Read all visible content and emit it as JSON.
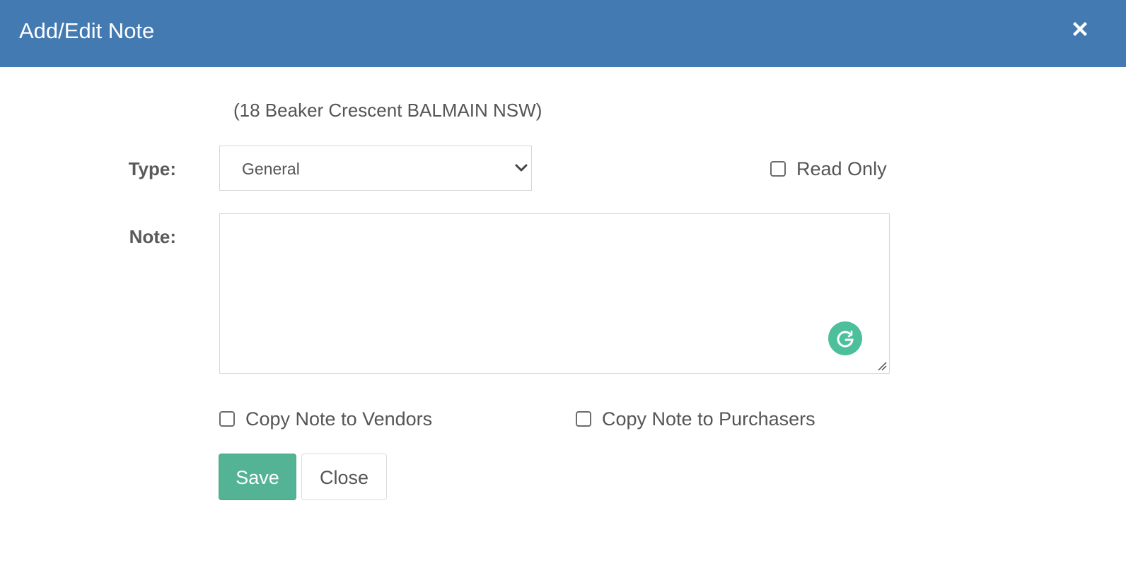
{
  "dialog": {
    "title": "Add/Edit Note",
    "close_icon": "close-icon",
    "header_color": "#447ab2"
  },
  "property": {
    "address": "(18 Beaker Crescent BALMAIN NSW)"
  },
  "form": {
    "type_label": "Type:",
    "type_selected": "General",
    "read_only_label": "Read Only",
    "read_only_checked": false,
    "note_label": "Note:",
    "note_value": "",
    "copy_vendors_label": "Copy Note to Vendors",
    "copy_vendors_checked": false,
    "copy_purchasers_label": "Copy Note to Purchasers",
    "copy_purchasers_checked": false
  },
  "actions": {
    "save_label": "Save",
    "close_label": "Close",
    "save_color": "#53b394"
  },
  "icons": {
    "grammarly": "grammarly-icon",
    "dropdown": "chevron-down-icon",
    "resize": "resize-grip-icon"
  }
}
